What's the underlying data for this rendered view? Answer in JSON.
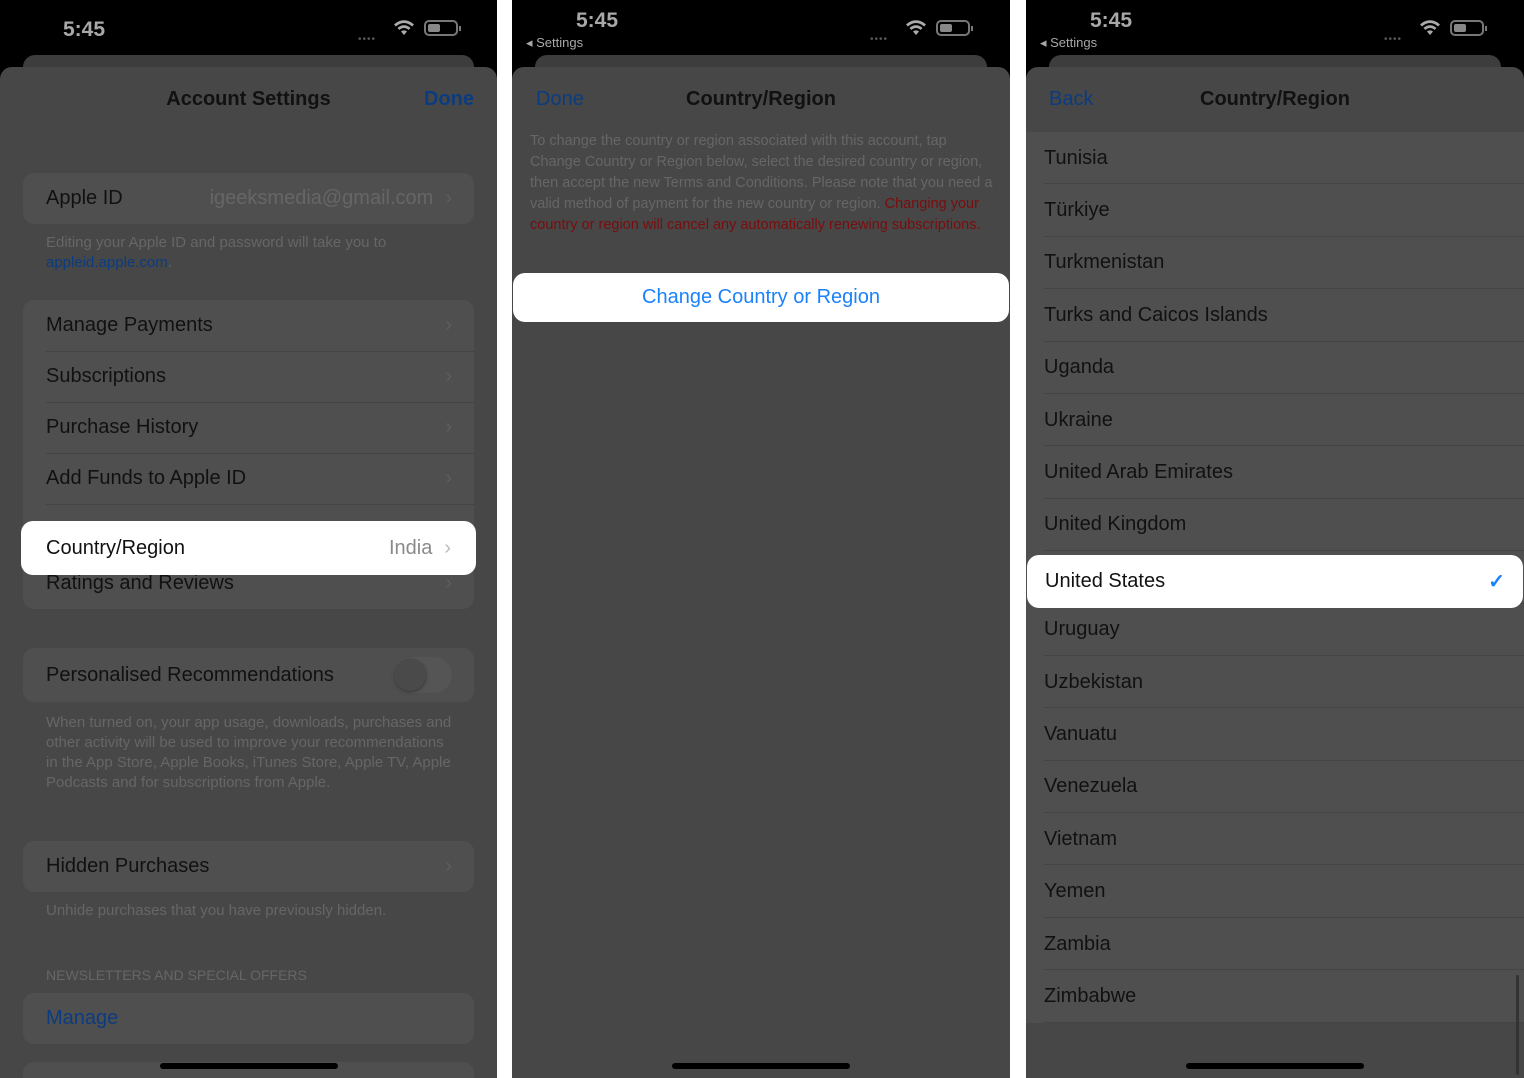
{
  "status": {
    "time": "5:45",
    "back_app": "Settings"
  },
  "panel1": {
    "title": "Account Settings",
    "done": "Done",
    "apple_id": {
      "label": "Apple ID",
      "value": "igeeksmedia@gmail.com"
    },
    "apple_id_footer": "Editing your Apple ID and password will take you to",
    "apple_id_link": "appleid.apple.com",
    "items": [
      {
        "label": "Manage Payments"
      },
      {
        "label": "Subscriptions"
      },
      {
        "label": "Purchase History"
      },
      {
        "label": "Add Funds to Apple ID"
      }
    ],
    "country": {
      "label": "Country/Region",
      "value": "India"
    },
    "ratings": "Ratings and Reviews",
    "personalised": {
      "label": "Personalised Recommendations",
      "on": false
    },
    "personalised_footer": "When turned on, your app usage, downloads, purchases and other activity will be used to improve your recommendations in the App Store, Apple Books, iTunes Store, Apple TV, Apple Podcasts and for subscriptions from Apple.",
    "hidden": "Hidden Purchases",
    "hidden_footer": "Unhide purchases that you have previously hidden.",
    "newsletters_header": "NEWSLETTERS AND SPECIAL OFFERS",
    "manage": "Manage"
  },
  "panel2": {
    "title": "Country/Region",
    "done": "Done",
    "description": "To change the country or region associated with this account, tap Change Country or Region below, select the desired country or region, then accept the new Terms and Conditions. Please note that you need a valid method of payment for the new country or region.",
    "warning": "Changing your country or region will cancel any automatically renewing subscriptions.",
    "button": "Change Country or Region"
  },
  "panel3": {
    "title": "Country/Region",
    "back": "Back",
    "countries": [
      "Tunisia",
      "Türkiye",
      "Turkmenistan",
      "Turks and Caicos Islands",
      "Uganda",
      "Ukraine",
      "United Arab Emirates",
      "United Kingdom",
      "United States",
      "Uruguay",
      "Uzbekistan",
      "Vanuatu",
      "Venezuela",
      "Vietnam",
      "Yemen",
      "Zambia",
      "Zimbabwe"
    ],
    "selected": "United States"
  },
  "colors": {
    "accent": "#1a82fb",
    "warning": "#7a0d0d"
  }
}
